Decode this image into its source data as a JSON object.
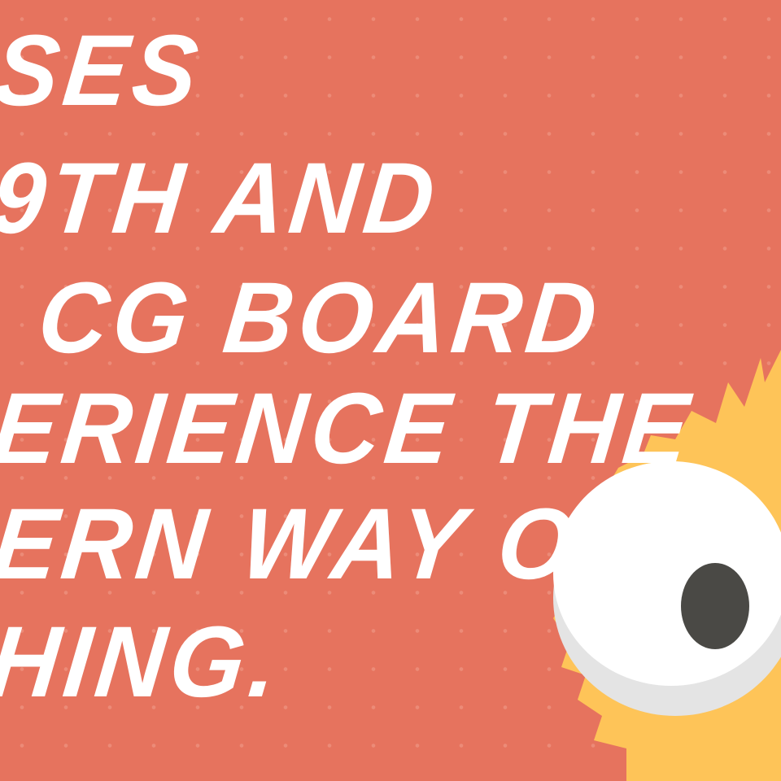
{
  "headline": {
    "lines": [
      "SES",
      "9TH AND",
      "CG BOARD",
      "ERIENCE THE",
      "ERN WAY OF",
      "HING."
    ]
  },
  "colors": {
    "background": "#e6735e",
    "text": "#ffffff",
    "burst": "#fec458",
    "eye_white": "#ffffff",
    "eye_shadow": "#e3e3e3",
    "pupil": "#4a4945"
  }
}
